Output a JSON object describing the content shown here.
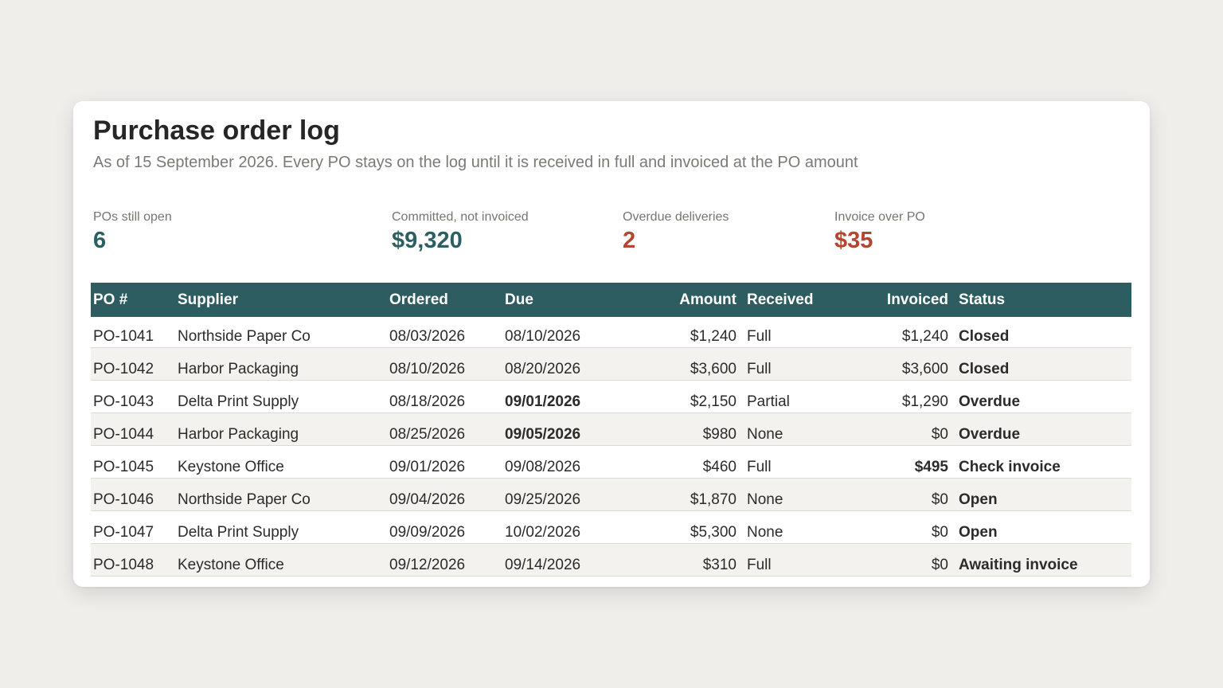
{
  "header": {
    "title": "Purchase order log",
    "subtitle": "As of 15 September 2026. Every PO stays on the log until it is received in full and invoiced at the PO amount"
  },
  "kpis": [
    {
      "label": "POs still open",
      "value": "6",
      "tone": "teal"
    },
    {
      "label": "Committed, not invoiced",
      "value": "$9,320",
      "tone": "teal"
    },
    {
      "label": "Overdue deliveries",
      "value": "2",
      "tone": "rust"
    },
    {
      "label": "Invoice over PO",
      "value": "$35",
      "tone": "rust"
    }
  ],
  "table": {
    "columns": [
      "PO #",
      "Supplier",
      "Ordered",
      "Due",
      "Amount",
      "Received",
      "Invoiced",
      "Status"
    ],
    "rows": [
      {
        "po": "PO-1041",
        "supplier": "Northside Paper Co",
        "ordered": "08/03/2026",
        "due": "08/10/2026",
        "amount": "$1,240",
        "received": "Full",
        "invoiced": "$1,240",
        "status": "Closed"
      },
      {
        "po": "PO-1042",
        "supplier": "Harbor Packaging",
        "ordered": "08/10/2026",
        "due": "08/20/2026",
        "amount": "$3,600",
        "received": "Full",
        "invoiced": "$3,600",
        "status": "Closed"
      },
      {
        "po": "PO-1043",
        "supplier": "Delta Print Supply",
        "ordered": "08/18/2026",
        "due": "09/01/2026",
        "amount": "$2,150",
        "received": "Partial",
        "invoiced": "$1,290",
        "status": "Overdue"
      },
      {
        "po": "PO-1044",
        "supplier": "Harbor Packaging",
        "ordered": "08/25/2026",
        "due": "09/05/2026",
        "amount": "$980",
        "received": "None",
        "invoiced": "$0",
        "status": "Overdue"
      },
      {
        "po": "PO-1045",
        "supplier": "Keystone Office",
        "ordered": "09/01/2026",
        "due": "09/08/2026",
        "amount": "$460",
        "received": "Full",
        "invoiced": "$495",
        "status": "Check invoice"
      },
      {
        "po": "PO-1046",
        "supplier": "Northside Paper Co",
        "ordered": "09/04/2026",
        "due": "09/25/2026",
        "amount": "$1,870",
        "received": "None",
        "invoiced": "$0",
        "status": "Open"
      },
      {
        "po": "PO-1047",
        "supplier": "Delta Print Supply",
        "ordered": "09/09/2026",
        "due": "10/02/2026",
        "amount": "$5,300",
        "received": "None",
        "invoiced": "$0",
        "status": "Open"
      },
      {
        "po": "PO-1048",
        "supplier": "Keystone Office",
        "ordered": "09/12/2026",
        "due": "09/14/2026",
        "amount": "$310",
        "received": "Full",
        "invoiced": "$0",
        "status": "Awaiting invoice"
      }
    ]
  },
  "colors": {
    "header_bg": "#2d5d61",
    "teal": "#2c5f62",
    "rust": "#b4452e",
    "closed_green": "#3d7043",
    "awaiting_gold": "#c29428",
    "page_bg": "#efeeeb"
  }
}
